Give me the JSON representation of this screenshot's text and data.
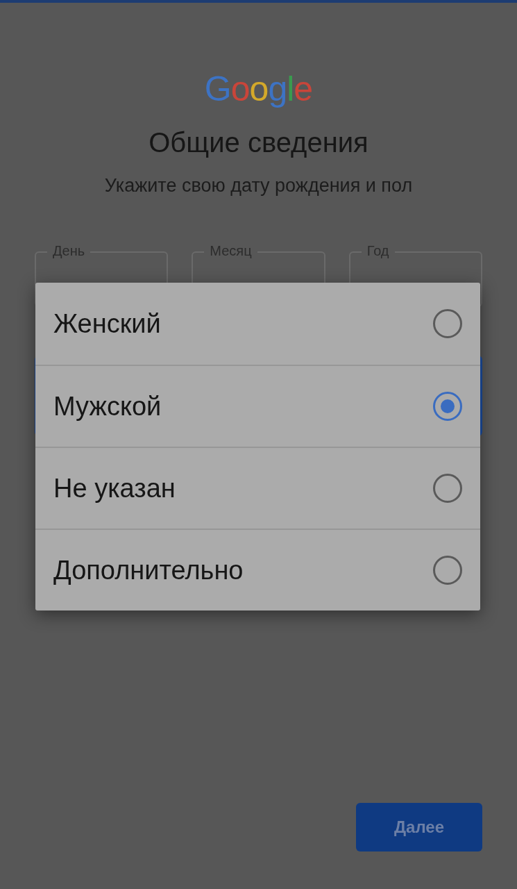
{
  "logo": "Google",
  "title": "Общие сведения",
  "subtitle": "Укажите свою дату рождения и пол",
  "date_fields": [
    {
      "label": "День"
    },
    {
      "label": "Месяц"
    },
    {
      "label": "Год"
    }
  ],
  "gender_field": {
    "focused": true
  },
  "gender_dialog": {
    "options": [
      {
        "label": "Женский",
        "selected": false
      },
      {
        "label": "Мужской",
        "selected": true
      },
      {
        "label": "Не указан",
        "selected": false
      },
      {
        "label": "Дополнительно",
        "selected": false
      }
    ]
  },
  "next_button": "Далее"
}
